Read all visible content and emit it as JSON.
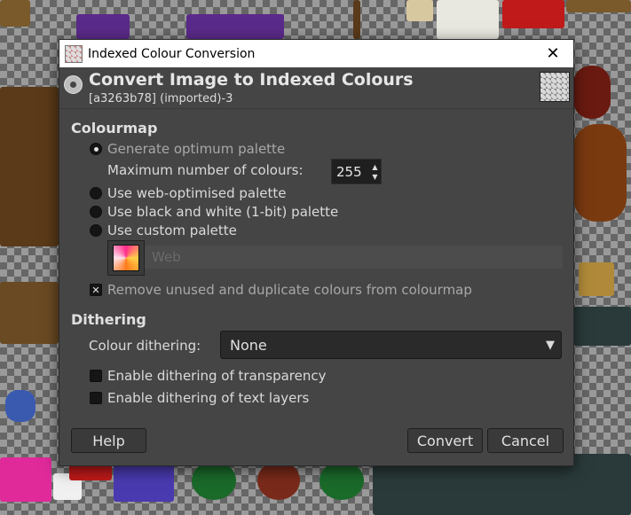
{
  "window": {
    "title": "Indexed Colour Conversion",
    "close_icon": "close-icon"
  },
  "header": {
    "title": "Convert Image to Indexed Colours",
    "subtitle": "[a3263b78] (imported)-3"
  },
  "colourmap": {
    "section_title": "Colourmap",
    "options": {
      "optimum": "Generate optimum palette",
      "web": "Use web-optimised palette",
      "bw": "Use black and white (1-bit) palette",
      "custom": "Use custom palette"
    },
    "selected": "optimum",
    "max_colours_label": "Maximum number of colours:",
    "max_colours_value": "255",
    "custom_palette_name": "Web",
    "remove_unused_label": "Remove unused and duplicate colours from colourmap",
    "remove_unused_checked": true
  },
  "dithering": {
    "section_title": "Dithering",
    "colour_dithering_label": "Colour dithering:",
    "colour_dithering_value": "None",
    "transparency_label": "Enable dithering of transparency",
    "text_layers_label": "Enable dithering of text layers"
  },
  "buttons": {
    "help": "Help",
    "convert": "Convert",
    "cancel": "Cancel"
  },
  "colors": {
    "dialog_bg": "#454545",
    "titlebar_bg": "#ffffff",
    "input_bg": "#1f1f1f"
  }
}
